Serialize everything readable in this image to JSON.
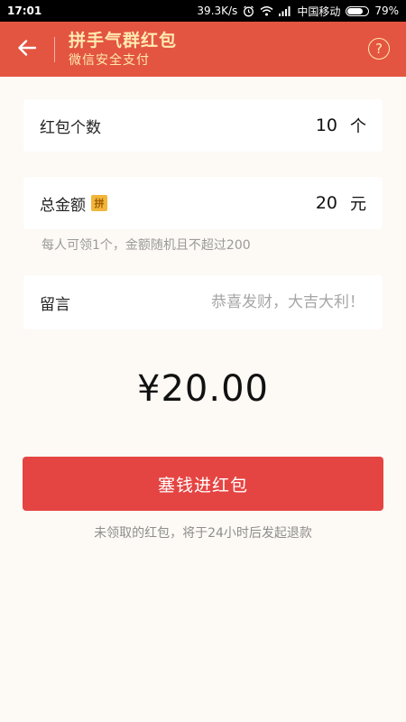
{
  "status_bar": {
    "time": "17:01",
    "network_speed": "39.3K/s",
    "carrier": "中国移动",
    "battery_percent": "79%",
    "battery_level": 0.79,
    "icons": [
      "alarm-icon",
      "wifi-icon",
      "signal-icon",
      "battery-icon"
    ]
  },
  "header": {
    "title": "拼手气群红包",
    "subtitle": "微信安全支付",
    "back_icon": "arrow-left-icon",
    "help_icon": "question-mark-icon",
    "help_label": "?",
    "bg_color": "#e35541",
    "text_color": "#ffe9b0"
  },
  "count_row": {
    "label": "红包个数",
    "value": "10",
    "unit": "个"
  },
  "amount_row": {
    "label": "总金额",
    "badge": "拼",
    "value": "20",
    "unit": "元"
  },
  "hint": "每人可领1个，金额随机且不超过200",
  "message_row": {
    "label": "留言",
    "placeholder": "恭喜发财，大吉大利！"
  },
  "total_display": "¥20.00",
  "submit_button": {
    "label": "塞钱进红包",
    "color": "#e54542"
  },
  "footer_note": "未领取的红包，将于24小时后发起退款"
}
